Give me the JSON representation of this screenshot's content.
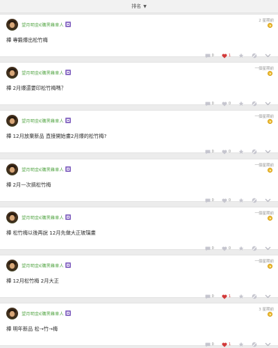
{
  "sort": {
    "label": "排名",
    "caret": "▼"
  },
  "posts": [
    {
      "author": "望月明金€購黑雞車人",
      "time": "2 星期前",
      "text": "樺 專鍛爆出松竹梅",
      "comments": "0",
      "likes": "1",
      "liked": true
    },
    {
      "author": "望月明金€購黑雞車人",
      "time": "一個星期前",
      "text": "樺 2月爆還要印松竹梅嗎？",
      "comments": "0",
      "likes": "0",
      "liked": false
    },
    {
      "author": "望月明金€購黑雞車人",
      "time": "一個星期前",
      "text": "樺 12月放棄新品 直接開始畫2月爆的松竹梅?",
      "comments": "0",
      "likes": "0",
      "liked": false
    },
    {
      "author": "望月明金€購黑雞車人",
      "time": "一個星期前",
      "text": "樺 2月一次搞松竹梅",
      "comments": "0",
      "likes": "0",
      "liked": false
    },
    {
      "author": "望月明金€購黑雞車人",
      "time": "一個星期前",
      "text": "樺 松竹梅以後再說 12月先做大正玻璃畫",
      "comments": "0",
      "likes": "0",
      "liked": false
    },
    {
      "author": "望月明金€購黑雞車人",
      "time": "一個星期前",
      "text": "樺 12月松竹梅 2月大正",
      "comments": "0",
      "likes": "1",
      "liked": true
    },
    {
      "author": "望月明金€購黑雞車人",
      "time": "3 星期前",
      "text": "樺 明年新品 松→竹→梅",
      "comments": "0",
      "likes": "1",
      "liked": true
    }
  ],
  "icons": {
    "comment": "comment-icon",
    "heart": "heart-icon",
    "star": "star-icon",
    "hide": "hide-icon",
    "expand": "chevron-down-icon",
    "coin": "coin-icon",
    "badge": "member-badge-icon"
  },
  "colors": {
    "author": "#58a84a",
    "liked_heart": "#d23b3b",
    "icon_gray": "#c6c6cf",
    "badge": "#8c6fc5",
    "coin": "#f0c23a"
  }
}
